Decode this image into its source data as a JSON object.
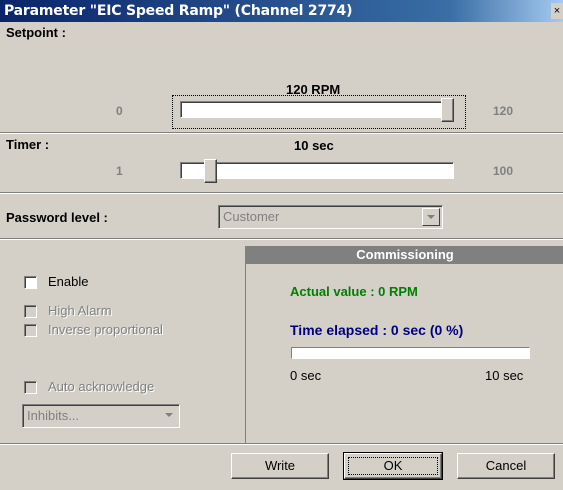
{
  "window": {
    "title": "Parameter \"EIC Speed Ramp\" (Channel 2774)",
    "close_glyph": "×"
  },
  "setpoint": {
    "label": "Setpoint :",
    "value_text": "120 RPM",
    "min": "0",
    "max": "120",
    "value": 120
  },
  "timer": {
    "label": "Timer :",
    "value_text": "10 sec",
    "min": "1",
    "max": "100",
    "value": 10
  },
  "password": {
    "label": "Password level :",
    "selected": "Customer"
  },
  "options": {
    "enable_label": "Enable",
    "high_alarm_label": "High Alarm",
    "inverse_label": "Inverse proportional",
    "auto_ack_label": "Auto acknowledge",
    "inhibits_selected": "Inhibits..."
  },
  "commissioning": {
    "header": "Commissioning",
    "actual_value": "Actual value : 0 RPM",
    "time_elapsed": "Time elapsed : 0 sec (0 %)",
    "progress_fraction": 0.0,
    "progress_start": "0 sec",
    "progress_end": "10 sec"
  },
  "buttons": {
    "write": "Write",
    "ok": "OK",
    "cancel": "Cancel"
  },
  "colors": {
    "face": "#d4d0c8",
    "title_blue": "#0a246a",
    "green_text": "#008000",
    "navy_text": "#000080",
    "section_gray": "#808080"
  }
}
